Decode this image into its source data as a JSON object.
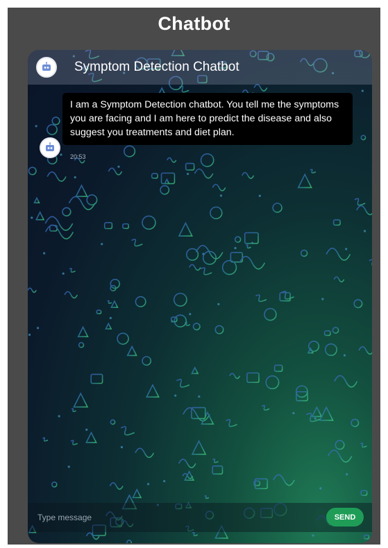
{
  "page": {
    "title": "Chatbot"
  },
  "chat": {
    "header_title": "Symptom Detection Chatbot",
    "bot_avatar_icon": "robot-icon",
    "background_icon": "doodle-pattern",
    "messages": [
      {
        "sender": "bot",
        "text": "I am a Symptom Detection chatbot. You tell me the symptoms you are facing and I am here to predict the disease and also suggest you treatments and diet plan.",
        "time": "20:53"
      }
    ]
  },
  "input": {
    "placeholder": "Type message",
    "value": "",
    "send_label": "SEND"
  },
  "colors": {
    "page_background": "#4a4a4a",
    "send_button": "#1f9d57",
    "bubble": "#000000",
    "doodle_blue": "#3f63c8",
    "doodle_green": "#3fcf7a"
  }
}
